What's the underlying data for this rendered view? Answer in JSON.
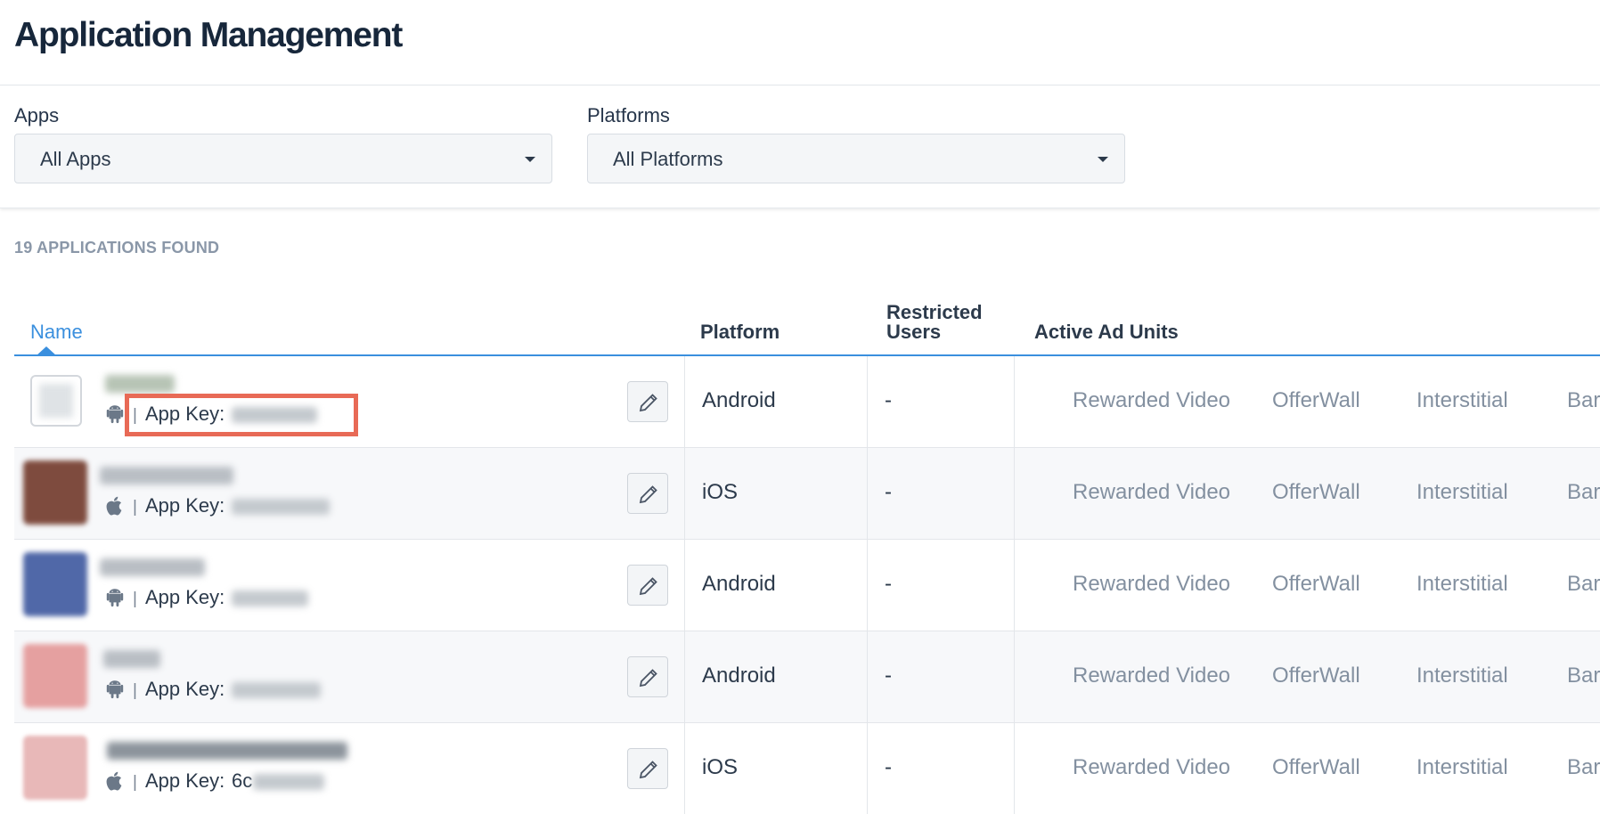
{
  "header": {
    "title": "Application Management"
  },
  "filters": {
    "apps": {
      "label": "Apps",
      "value": "All Apps"
    },
    "platforms": {
      "label": "Platforms",
      "value": "All Platforms"
    }
  },
  "results": {
    "count_text": "19 APPLICATIONS FOUND"
  },
  "table": {
    "columns": {
      "name": "Name",
      "platform": "Platform",
      "restricted_users": "Restricted Users",
      "active_ad_units": "Active Ad Units"
    },
    "rows": [
      {
        "platform": "Android",
        "platform_icon": "android-icon",
        "restricted": "-",
        "app_key_label": "App Key:",
        "app_key_visible": "",
        "ad_units": [
          "Rewarded Video",
          "OfferWall",
          "Interstitial",
          "Bar"
        ]
      },
      {
        "platform": "iOS",
        "platform_icon": "apple-icon",
        "restricted": "-",
        "app_key_label": "App Key:",
        "app_key_visible": "",
        "ad_units": [
          "Rewarded Video",
          "OfferWall",
          "Interstitial",
          "Bar"
        ]
      },
      {
        "platform": "Android",
        "platform_icon": "android-icon",
        "restricted": "-",
        "app_key_label": "App Key:",
        "app_key_visible": "",
        "ad_units": [
          "Rewarded Video",
          "OfferWall",
          "Interstitial",
          "Bar"
        ]
      },
      {
        "platform": "Android",
        "platform_icon": "android-icon",
        "restricted": "-",
        "app_key_label": "App Key:",
        "app_key_visible": "",
        "ad_units": [
          "Rewarded Video",
          "OfferWall",
          "Interstitial",
          "Bar"
        ]
      },
      {
        "platform": "iOS",
        "platform_icon": "apple-icon",
        "restricted": "-",
        "app_key_label": "App Key:",
        "app_key_visible": "6c",
        "ad_units": [
          "Rewarded Video",
          "OfferWall",
          "Interstitial",
          "Bar"
        ]
      }
    ]
  },
  "colors": {
    "accent": "#3a8fde",
    "highlight": "#e86a56",
    "muted_text": "#8390a0"
  },
  "icons": {
    "edit": "pencil-icon",
    "caret": "caret-down-icon",
    "android": "android-icon",
    "apple": "apple-icon"
  }
}
